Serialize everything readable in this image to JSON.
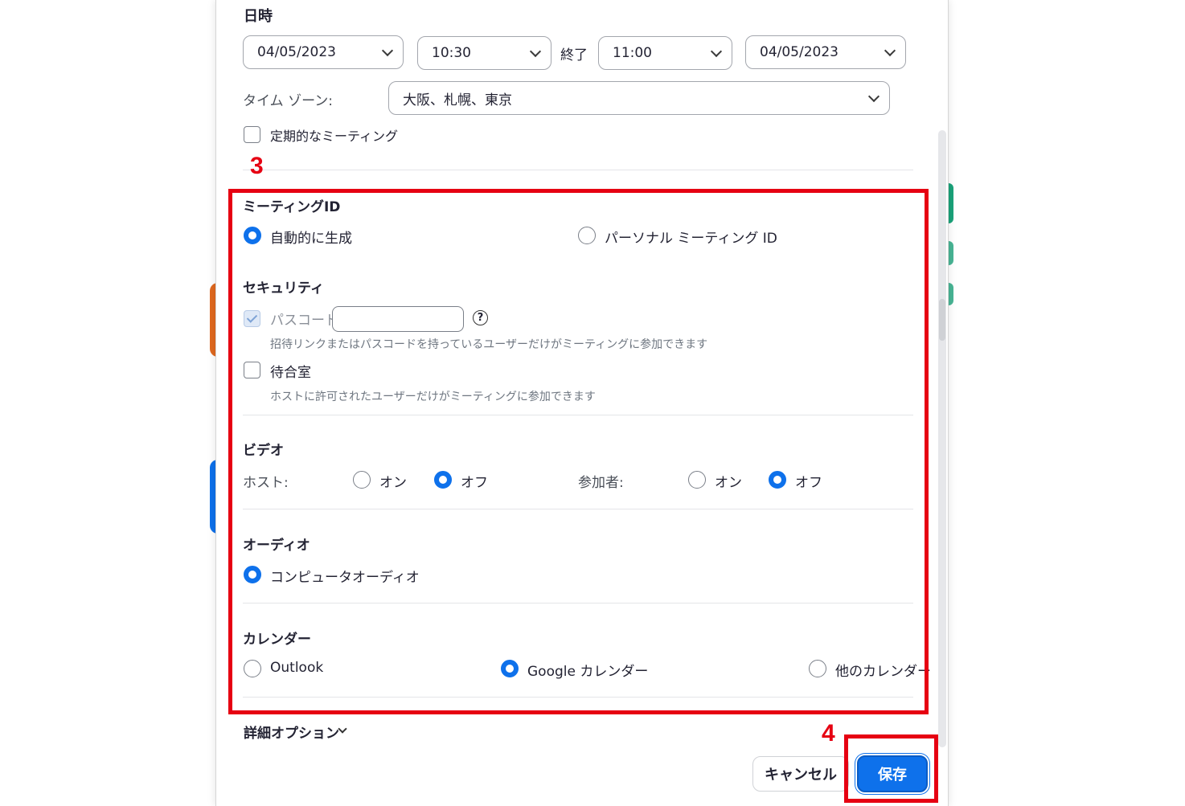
{
  "datetime": {
    "section_title": "日時",
    "start_date": "04/05/2023",
    "start_time": "10:30",
    "end_label": "終了",
    "end_time": "11:00",
    "end_date": "04/05/2023"
  },
  "timezone": {
    "label": "タイム ゾーン:",
    "value": "大阪、札幌、東京"
  },
  "recurring": {
    "label": "定期的なミーティング",
    "checked": false
  },
  "meeting_id": {
    "title": "ミーティングID",
    "options": [
      {
        "label": "自動的に生成",
        "selected": true
      },
      {
        "label": "パーソナル ミーティング ID",
        "selected": false
      }
    ]
  },
  "security": {
    "title": "セキュリティ",
    "passcode_label": "パスコード",
    "passcode_value": "",
    "passcode_checked": true,
    "passcode_help": "?",
    "passcode_desc": "招待リンクまたはパスコードを持っているユーザーだけがミーティングに参加できます",
    "waiting_room_label": "待合室",
    "waiting_room_checked": false,
    "waiting_room_desc": "ホストに許可されたユーザーだけがミーティングに参加できます"
  },
  "video": {
    "title": "ビデオ",
    "host_label": "ホスト:",
    "participant_label": "参加者:",
    "on_label": "オン",
    "off_label": "オフ",
    "host_value": "off",
    "participant_value": "off"
  },
  "audio": {
    "title": "オーディオ",
    "option": "コンピュータオーディオ"
  },
  "calendar": {
    "title": "カレンダー",
    "options": [
      {
        "label": "Outlook",
        "selected": false
      },
      {
        "label": "Google カレンダー",
        "selected": true
      },
      {
        "label": "他のカレンダー",
        "selected": false
      }
    ]
  },
  "advanced_options_label": "詳細オプション",
  "buttons": {
    "cancel": "キャンセル",
    "save": "保存"
  },
  "annotations": {
    "step3": "3",
    "step4": "4",
    "color": "#e60012"
  },
  "colors": {
    "accent": "#0e71eb",
    "text": "#232333"
  }
}
